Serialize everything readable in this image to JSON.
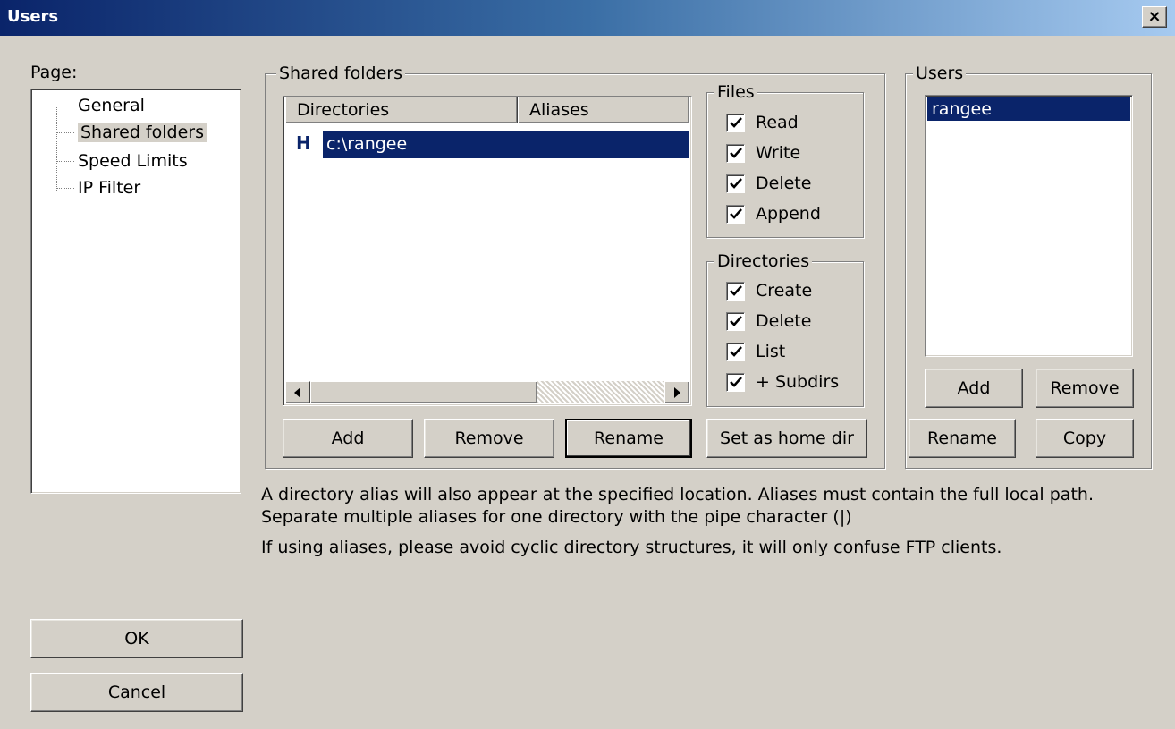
{
  "window": {
    "title": "Users",
    "close_label": "×"
  },
  "page_label": "Page:",
  "tree": [
    {
      "label": "General",
      "selected": false
    },
    {
      "label": "Shared folders",
      "selected": true
    },
    {
      "label": "Speed Limits",
      "selected": false
    },
    {
      "label": "IP Filter",
      "selected": false
    }
  ],
  "shared_folders": {
    "legend": "Shared folders",
    "columns": [
      "Directories",
      "Aliases"
    ],
    "rows": [
      {
        "flag": "H",
        "directory": "c:\\rangee",
        "alias": ""
      }
    ],
    "buttons": {
      "add": "Add",
      "remove": "Remove",
      "rename": "Rename",
      "set_home": "Set as home dir"
    }
  },
  "files": {
    "legend": "Files",
    "options": [
      {
        "label": "Read",
        "checked": true
      },
      {
        "label": "Write",
        "checked": true
      },
      {
        "label": "Delete",
        "checked": true
      },
      {
        "label": "Append",
        "checked": true
      }
    ]
  },
  "directories": {
    "legend": "Directories",
    "options": [
      {
        "label": "Create",
        "checked": true
      },
      {
        "label": "Delete",
        "checked": true
      },
      {
        "label": "List",
        "checked": true
      },
      {
        "label": "+ Subdirs",
        "checked": true
      }
    ]
  },
  "users": {
    "legend": "Users",
    "list": [
      "rangee"
    ],
    "buttons": {
      "add": "Add",
      "remove": "Remove",
      "rename": "Rename",
      "copy": "Copy"
    }
  },
  "help": {
    "line1": "A directory alias will also appear at the specified location. Aliases must contain the full local path. Separate multiple aliases for one directory with the pipe character (|)",
    "line2": "If using aliases, please avoid cyclic directory structures, it will only confuse FTP clients."
  },
  "dialog_buttons": {
    "ok": "OK",
    "cancel": "Cancel"
  },
  "colors": {
    "title_start": "#0a246a",
    "title_end": "#a6caf0",
    "selection": "#0a246a",
    "face": "#d4d0c8"
  }
}
